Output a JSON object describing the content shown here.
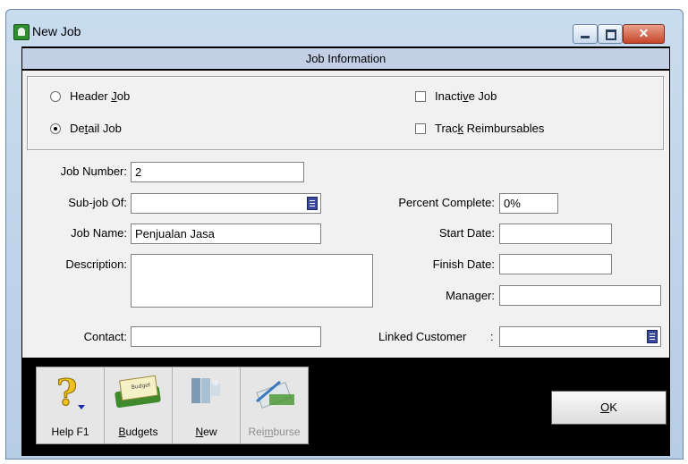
{
  "window": {
    "title": "New Job"
  },
  "header": {
    "title": "Job Information"
  },
  "job_type": {
    "header_job": {
      "label": "Header Job",
      "selected": false
    },
    "detail_job": {
      "label": "Detail Job",
      "selected": true
    }
  },
  "options": {
    "inactive_job": {
      "label": "Inactive Job",
      "checked": false
    },
    "track_reimbursables": {
      "label": "Track Reimbursables",
      "checked": false
    }
  },
  "fields": {
    "job_number": {
      "label": "Job Number:",
      "value": "2"
    },
    "sub_job_of": {
      "label": "Sub-job Of:",
      "value": ""
    },
    "job_name": {
      "label": "Job Name:",
      "value": "Penjualan Jasa"
    },
    "description": {
      "label": "Description:",
      "value": ""
    },
    "contact": {
      "label": "Contact:",
      "value": ""
    },
    "percent_complete": {
      "label": "Percent Complete:",
      "value": "0%"
    },
    "start_date": {
      "label": "Start Date:",
      "value": ""
    },
    "finish_date": {
      "label": "Finish Date:",
      "value": ""
    },
    "manager": {
      "label": "Manager:",
      "value": ""
    },
    "linked_customer": {
      "label": "Linked Customer",
      "separator": ":",
      "value": ""
    }
  },
  "toolbar": {
    "help": {
      "label": "Help F1",
      "icon": "help-question-icon"
    },
    "budgets": {
      "label": "Budgets",
      "icon": "budget-icon"
    },
    "new": {
      "label": "New",
      "icon": "new-job-icon"
    },
    "reimburse": {
      "label": "Reimburse",
      "icon": "reimburse-icon",
      "enabled": false
    }
  },
  "buttons": {
    "ok": "OK"
  },
  "colors": {
    "titlebar": "#c9dcef",
    "header_bar": "#c2cfe5",
    "panel": "#f1f1f1",
    "client_bg": "#000000"
  }
}
